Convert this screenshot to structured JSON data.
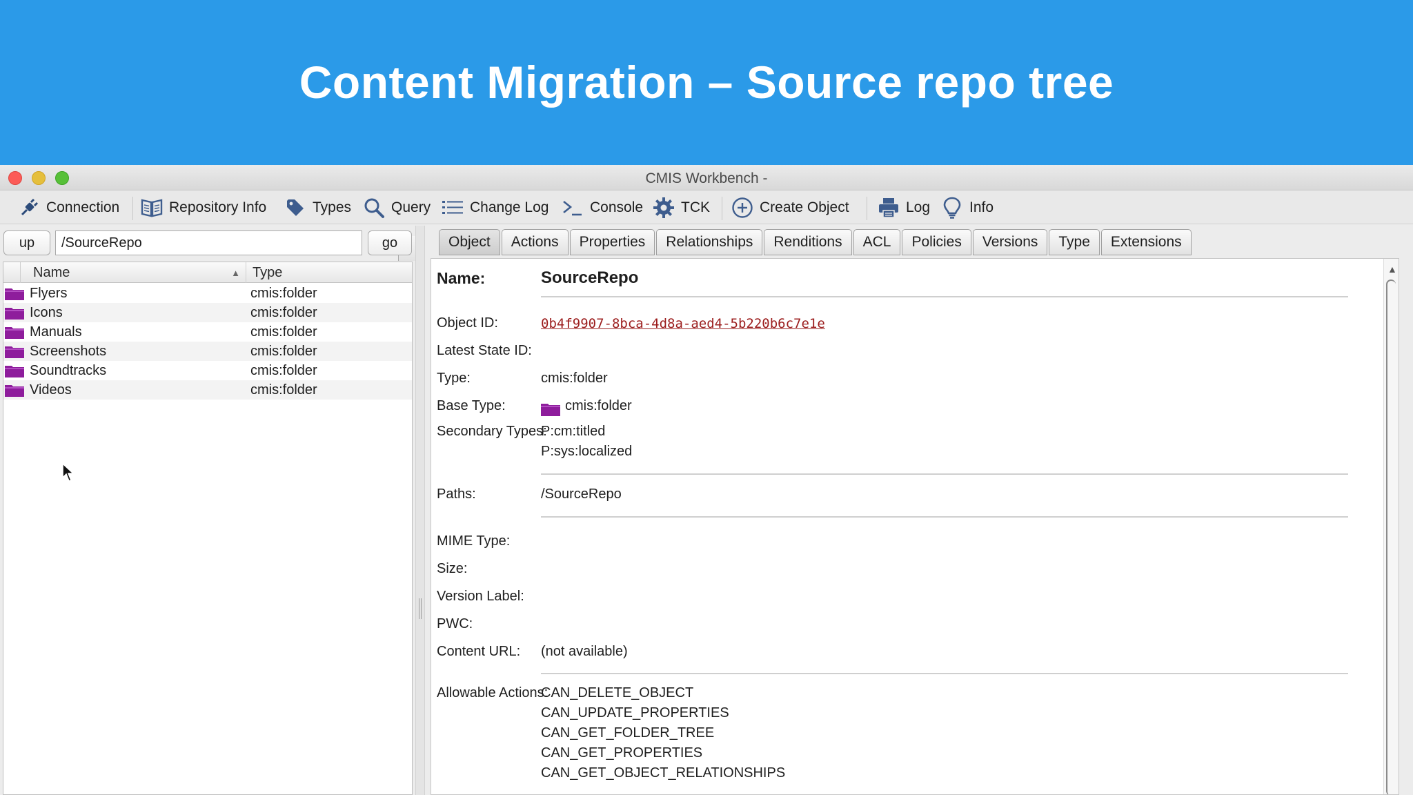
{
  "banner": {
    "title": "Content Migration – Source repo tree"
  },
  "window": {
    "title": "CMIS Workbench -"
  },
  "toolbar": {
    "items": [
      {
        "label": "Connection",
        "icon": "plug-icon"
      },
      {
        "label": "Repository Info",
        "icon": "book-icon"
      },
      {
        "label": "Types",
        "icon": "tag-icon"
      },
      {
        "label": "Query",
        "icon": "magnifier-icon"
      },
      {
        "label": "Change Log",
        "icon": "list-icon"
      },
      {
        "label": "Console",
        "icon": "terminal-icon"
      },
      {
        "label": "TCK",
        "icon": "gear-icon"
      },
      {
        "label": "Create Object",
        "icon": "plus-circle-icon"
      },
      {
        "label": "Log",
        "icon": "printer-icon"
      },
      {
        "label": "Info",
        "icon": "lightbulb-icon"
      }
    ]
  },
  "navigation": {
    "up_label": "up",
    "path": "/SourceRepo",
    "go_label": "go"
  },
  "tree": {
    "columns": [
      "Name",
      "Type"
    ],
    "rows": [
      {
        "name": "Flyers",
        "type": "cmis:folder"
      },
      {
        "name": "Icons",
        "type": "cmis:folder"
      },
      {
        "name": "Manuals",
        "type": "cmis:folder"
      },
      {
        "name": "Screenshots",
        "type": "cmis:folder"
      },
      {
        "name": "Soundtracks",
        "type": "cmis:folder"
      },
      {
        "name": "Videos",
        "type": "cmis:folder"
      }
    ]
  },
  "tabs": [
    "Object",
    "Actions",
    "Properties",
    "Relationships",
    "Renditions",
    "ACL",
    "Policies",
    "Versions",
    "Type",
    "Extensions"
  ],
  "object": {
    "name_label": "Name:",
    "name": "SourceRepo",
    "object_id_label": "Object ID:",
    "object_id": "0b4f9907-8bca-4d8a-aed4-5b220b6c7e1e",
    "latest_state_label": "Latest State ID:",
    "type_label": "Type:",
    "type": "cmis:folder",
    "base_type_label": "Base Type:",
    "base_type": "cmis:folder",
    "secondary_label": "Secondary Types:",
    "secondary_types": [
      "P:cm:titled",
      "P:sys:localized"
    ],
    "paths_label": "Paths:",
    "paths": "/SourceRepo",
    "mime_label": "MIME Type:",
    "size_label": "Size:",
    "version_label": "Version Label:",
    "pwc_label": "PWC:",
    "content_url_label": "Content URL:",
    "content_url": "(not available)",
    "allowable_label": "Allowable Actions:",
    "allowable_actions": [
      "CAN_DELETE_OBJECT",
      "CAN_UPDATE_PROPERTIES",
      "CAN_GET_FOLDER_TREE",
      "CAN_GET_PROPERTIES",
      "CAN_GET_OBJECT_RELATIONSHIPS"
    ]
  },
  "colors": {
    "banner": "#2b9ae8",
    "folder": "#8e1d9c",
    "link": "#9b1c1c"
  }
}
